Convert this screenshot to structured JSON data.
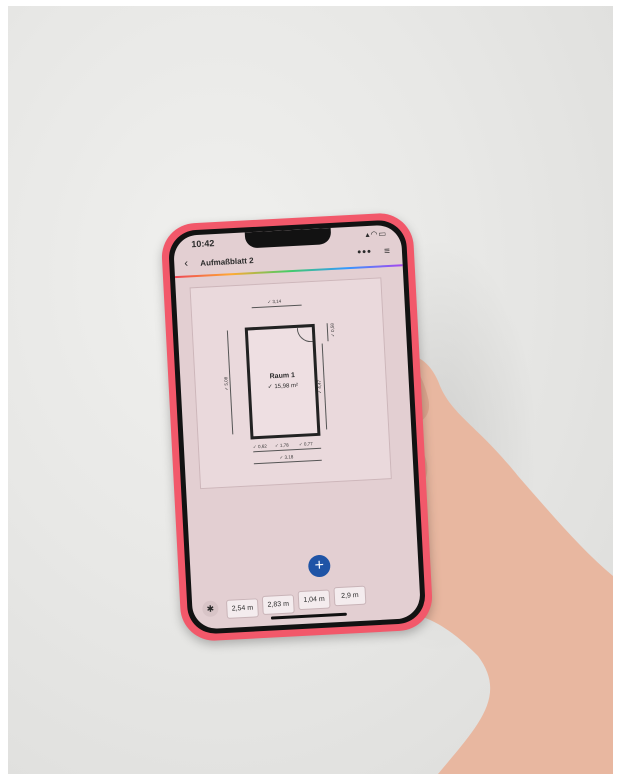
{
  "status": {
    "time": "10:42",
    "icons": "▴◠▭"
  },
  "header": {
    "back": "‹",
    "title": "Aufmaßblatt 2",
    "more": "•••",
    "menu": "≡"
  },
  "plan": {
    "room_name": "Raum 1",
    "room_area": "✓ 15,98 m²",
    "dimensions": {
      "top": "✓ 3,14",
      "left": "✓ 5,08",
      "right_outer": "✓ 0,58",
      "right_inner": "✓ 4,47",
      "bottom_a": "✓ 0,62",
      "bottom_b": "✓ 1,78",
      "bottom_c": "✓ 0,77",
      "bottom_total": "✓ 3,18"
    }
  },
  "fab": {
    "label": "+"
  },
  "bluetooth": {
    "icon": "✱"
  },
  "measurements": [
    "2,54 m",
    "2,83 m",
    "1,04 m",
    "2,9 m"
  ]
}
